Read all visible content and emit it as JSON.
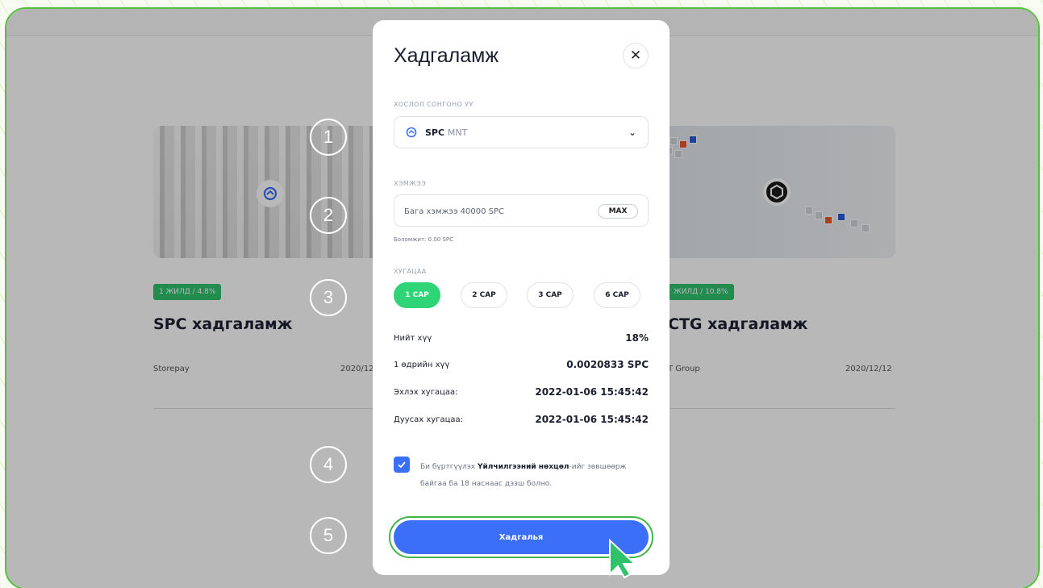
{
  "background": {
    "cards": [
      {
        "badge": "1 ЖИЛД / 4.8%",
        "title": "SPC хадгаламж",
        "provider": "Storepay",
        "date": "2020/12"
      },
      {
        "badge": "ЖИЛД / 10.8%",
        "title": "CTG хадгаламж",
        "provider": "T Group",
        "date": "2020/12/12"
      }
    ]
  },
  "steps": [
    "1",
    "2",
    "3",
    "4",
    "5"
  ],
  "modal": {
    "title": "Хадгаламж",
    "close_icon": "close-icon",
    "pair_label": "ХОСЛОЛ СОНГОНО УУ",
    "pair_value": "SPC",
    "pair_quote": "MNT",
    "amount_label": "ХЭМЖЭЭ",
    "amount_placeholder": "Бага хэмжээ 40000 SPC",
    "max_label": "MAX",
    "balance": "Боломжит: 0.00 SPC",
    "duration_label": "ХУГАЦАА",
    "durations": [
      "1 САР",
      "2 САР",
      "3 САР",
      "6 САР"
    ],
    "selected_duration": "1 САР",
    "summary": [
      {
        "label": "Нийт хүү",
        "value": "18%"
      },
      {
        "label": "1 өдрийн хүү",
        "value": "0.0020833 SPC"
      },
      {
        "label": "Эхлэх хугацаа:",
        "value": "2022-01-06 15:45:42"
      },
      {
        "label": "Дуусах хугацаа:",
        "value": "2022-01-06 15:45:42"
      }
    ],
    "agree_prefix": "Би бүртгүүлэх ",
    "agree_link": "Үйлчилгээний нөхцөл",
    "agree_suffix": "-ийг зөвшөөрж байгаа ба 18 наснаас дээш болно.",
    "agree_checked": true,
    "submit_label": "Хадгалья"
  },
  "colors": {
    "accent_green": "#2fd477",
    "primary_blue": "#3b6ff7",
    "frame_green": "#55c03a"
  }
}
